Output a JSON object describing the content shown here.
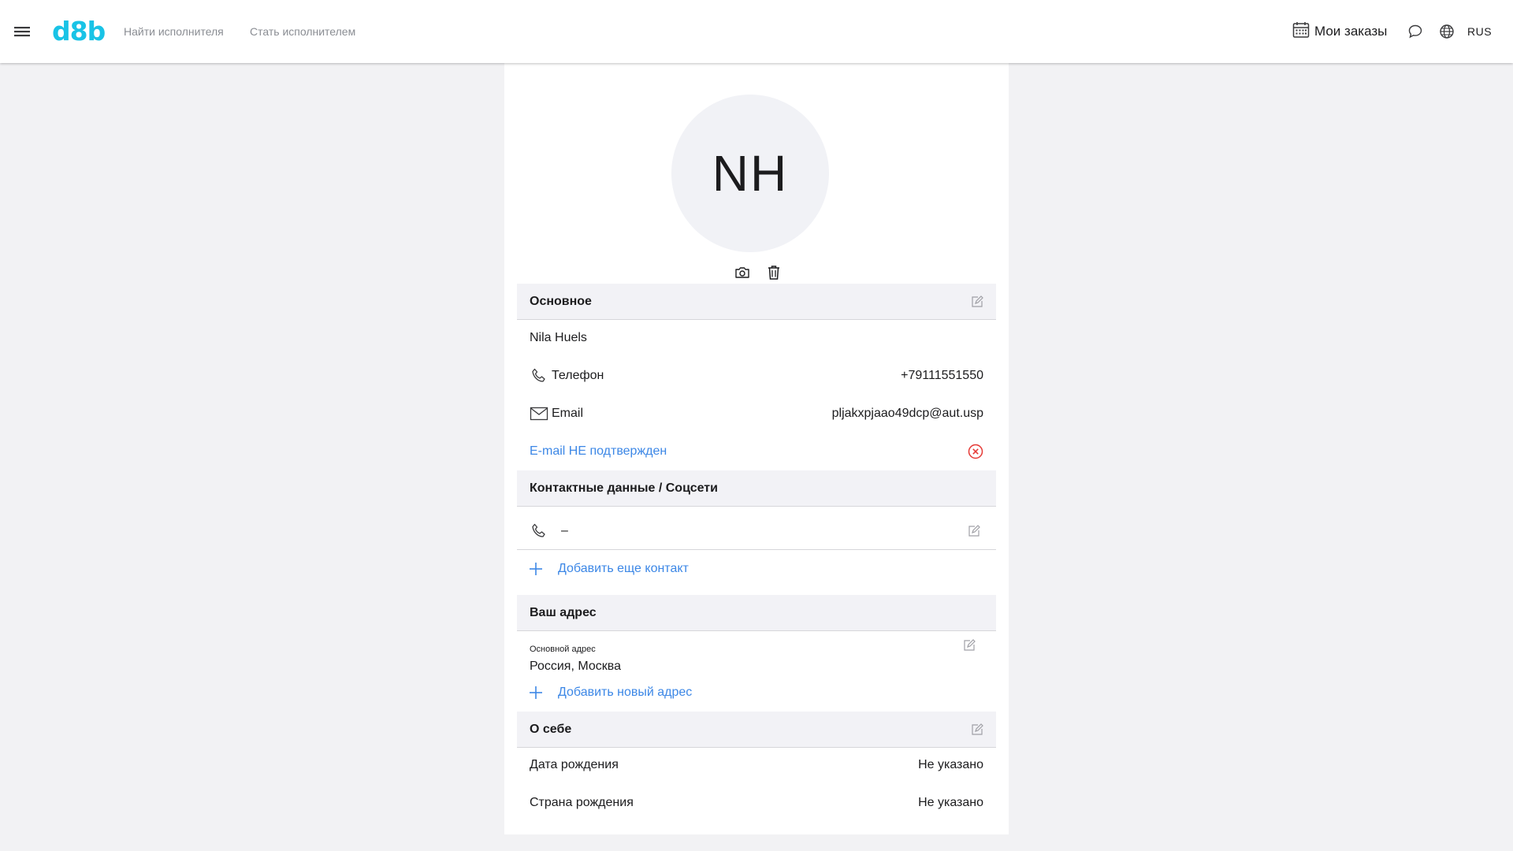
{
  "header": {
    "logo": "d8b",
    "nav": {
      "find_performer": "Найти исполнителя",
      "become_performer": "Стать исполнителем"
    },
    "my_orders": "Мои заказы",
    "language": "RUS",
    "icons": [
      "menu-icon",
      "calendar-icon",
      "chat-icon",
      "globe-icon"
    ]
  },
  "profile": {
    "initials": "NH",
    "avatar_tools": [
      "camera-icon",
      "trash-icon"
    ],
    "basic": {
      "title": "Основное",
      "name": "Nila Huels",
      "phone_label": "Телефон",
      "phone_value": "+79111551550",
      "email_label": "Email",
      "email_value": "pljakxpjaao49dcp@aut.usp",
      "email_status": "E-mail НЕ подтвержден"
    },
    "contacts": {
      "title": "Контактные данные / Соцсети",
      "phone_value": "–",
      "add_contact": "Добавить еще контакт"
    },
    "address": {
      "title": "Ваш адрес",
      "main_label": "Основной адрес",
      "main_value": "Россия, Москва",
      "add_address": "Добавить новый адрес"
    },
    "about": {
      "title": "О себе",
      "birth_date_label": "Дата рождения",
      "birth_date_value": "Не указано",
      "birth_country_label": "Страна рождения",
      "birth_country_value": "Не указано"
    }
  },
  "colors": {
    "brand": "#19c3e6",
    "link": "#3c87e6",
    "error": "#e53935",
    "section_bg": "#f2f2f6",
    "page_bg": "#f2f2f4"
  }
}
